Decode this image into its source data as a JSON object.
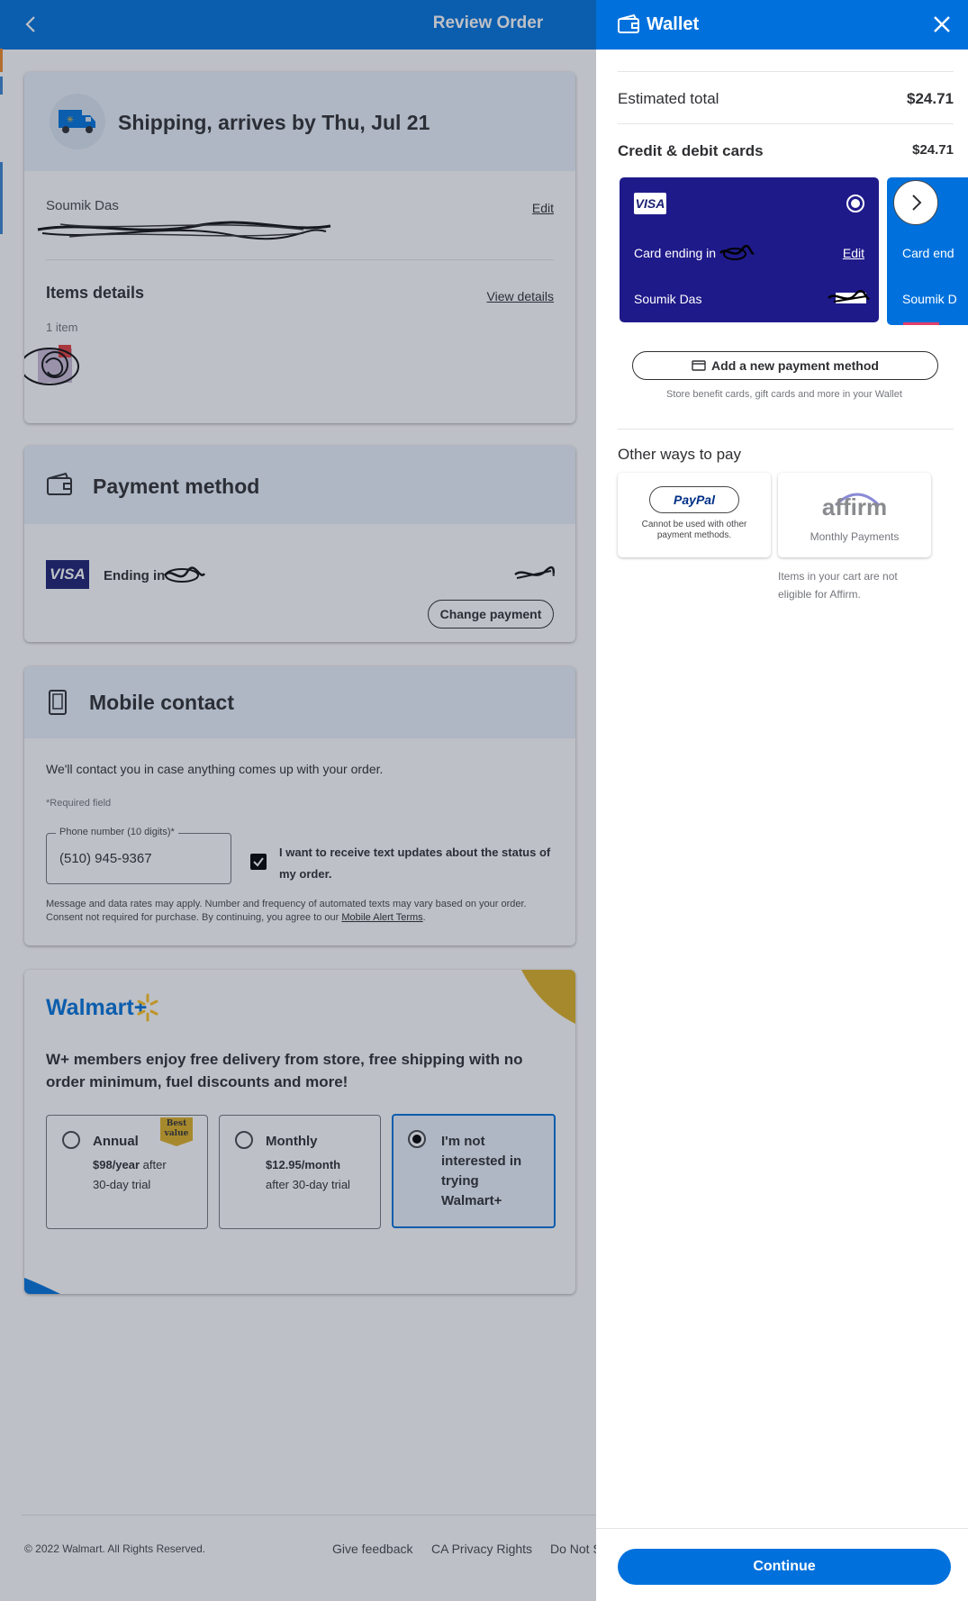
{
  "review": {
    "title": "Review Order",
    "shipping_title": "Shipping, arrives by Thu, Jul 21",
    "customer_name": "Soumik Das",
    "edit_label": "Edit",
    "items_title": "Items details",
    "view_details": "View details",
    "item_count": "1 item",
    "payment_title": "Payment method",
    "payment_visa": "VISA",
    "payment_ending": "Ending in",
    "change_payment": "Change payment",
    "mobile_title": "Mobile contact",
    "mobile_desc": "We'll contact you in case anything comes up with your order.",
    "required_field": "*Required field",
    "phone_label": "Phone number (10 digits)*",
    "phone_value": "(510) 945-9367",
    "sms_optin": "I want to receive text updates about the status of my order.",
    "disclaimer_line1": "Message and data rates may apply. Number and frequency of automated texts may vary based on your order.",
    "disclaimer_line2": "Consent not required for purchase. By continuing, you agree to our",
    "alert_terms": "Mobile Alert Terms",
    "period": "."
  },
  "walmart_plus": {
    "logo": "Walmart+",
    "headline": "W+ members enjoy free delivery from store, free shipping with no order minimum, fuel discounts and more!",
    "plans": [
      {
        "name": "Annual",
        "price": "$98/year",
        "price_suffix": " after",
        "trial": "30-day trial",
        "badge": "Best value"
      },
      {
        "name": "Monthly",
        "price": "$12.95/month",
        "trial": "after 30-day trial"
      },
      {
        "name": "I'm not interested in trying Walmart+"
      }
    ]
  },
  "footer": {
    "copyright": "© 2022 Walmart. All Rights Reserved.",
    "links": [
      "Give feedback",
      "CA Privacy Rights",
      "Do Not S"
    ]
  },
  "wallet": {
    "title": "Wallet",
    "estimated_total_label": "Estimated total",
    "estimated_total_value": "$24.71",
    "cards_label": "Credit & debit cards",
    "cards_value": "$24.71",
    "card1": {
      "brand": "VISA",
      "ending": "Card ending in",
      "edit": "Edit",
      "name": "Soumik Das"
    },
    "card2": {
      "ending": "Card end",
      "name": "Soumik D"
    },
    "add_payment": "Add a new payment method",
    "store_note": "Store benefit cards, gift cards and more in your Wallet",
    "other_ways": "Other ways to pay",
    "paypal": {
      "logo": "PayPal",
      "note": "Cannot be used with other payment methods."
    },
    "affirm": {
      "logo": "affirm",
      "note": "Monthly Payments",
      "ineligible": "Items in your cart are not eligible for Affirm."
    },
    "continue": "Continue"
  },
  "colors": {
    "walmart_blue": "#0071dc",
    "navy_card": "#1f1a8a",
    "spark_yellow": "#ffc220"
  }
}
